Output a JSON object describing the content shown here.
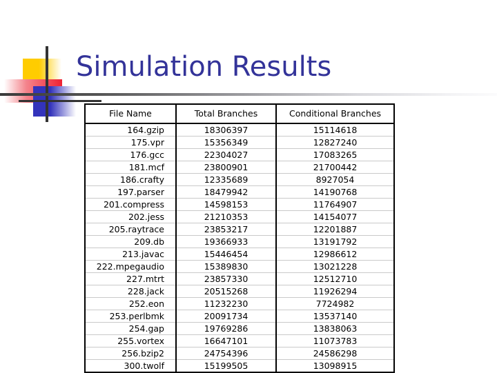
{
  "slide": {
    "title": "Simulation Results"
  },
  "decoration": {
    "yellow_square_color": "#FFCC00",
    "red_square_color": "#EE2233",
    "blue_square_color": "#3333BB",
    "crosshair_color": "#333333",
    "title_color": "#333399",
    "rule_color_start": "#3a3a3a",
    "rule_color_end": "#fbfbfc"
  },
  "table": {
    "columns": [
      "File Name",
      "Total Branches",
      "Conditional Branches"
    ],
    "rows": [
      {
        "file": "164.gzip",
        "total": "18306397",
        "conditional": "15114618"
      },
      {
        "file": "175.vpr",
        "total": "15356349",
        "conditional": "12827240"
      },
      {
        "file": "176.gcc",
        "total": "22304027",
        "conditional": "17083265"
      },
      {
        "file": "181.mcf",
        "total": "23800901",
        "conditional": "21700442"
      },
      {
        "file": "186.crafty",
        "total": "12335689",
        "conditional": "8927054"
      },
      {
        "file": "197.parser",
        "total": "18479942",
        "conditional": "14190768"
      },
      {
        "file": "201.compress",
        "total": "14598153",
        "conditional": "11764907"
      },
      {
        "file": "202.jess",
        "total": "21210353",
        "conditional": "14154077"
      },
      {
        "file": "205.raytrace",
        "total": "23853217",
        "conditional": "12201887"
      },
      {
        "file": "209.db",
        "total": "19366933",
        "conditional": "13191792"
      },
      {
        "file": "213.javac",
        "total": "15446454",
        "conditional": "12986612"
      },
      {
        "file": "222.mpegaudio",
        "total": "15389830",
        "conditional": "13021228"
      },
      {
        "file": "227.mtrt",
        "total": "23857330",
        "conditional": "12512710"
      },
      {
        "file": "228.jack",
        "total": "20515268",
        "conditional": "11926294"
      },
      {
        "file": "252.eon",
        "total": "11232230",
        "conditional": "7724982"
      },
      {
        "file": "253.perlbmk",
        "total": "20091734",
        "conditional": "13537140"
      },
      {
        "file": "254.gap",
        "total": "19769286",
        "conditional": "13838063"
      },
      {
        "file": "255.vortex",
        "total": "16647101",
        "conditional": "11073783"
      },
      {
        "file": "256.bzip2",
        "total": "24754396",
        "conditional": "24586298"
      },
      {
        "file": "300.twolf",
        "total": "15199505",
        "conditional": "13098915"
      }
    ]
  }
}
